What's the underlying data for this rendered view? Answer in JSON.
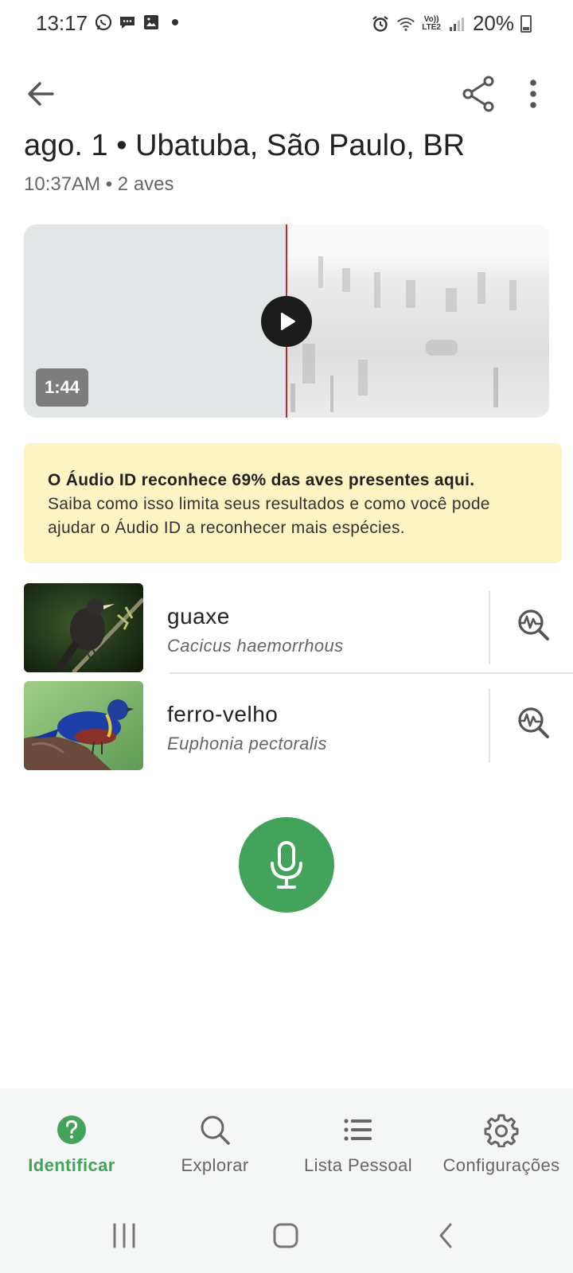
{
  "status_bar": {
    "time": "13:17",
    "battery": "20%",
    "volte_line1": "Vo))",
    "volte_line2": "LTE2"
  },
  "header": {
    "title": "ago. 1 • Ubatuba, São Paulo, BR",
    "subtitle": "10:37AM • 2 aves"
  },
  "player": {
    "duration": "1:44",
    "progress": 0.5
  },
  "notice": {
    "bold": "O Áudio ID reconhece 69% das aves presentes aqui.",
    "text": "Saiba como isso limita seus resultados e como você pode ajudar o Áudio ID a reconhecer mais espécies."
  },
  "birds": [
    {
      "name": "guaxe",
      "scientific": "Cacicus haemorrhous",
      "icon": "spectrogram-search-icon"
    },
    {
      "name": "ferro-velho",
      "scientific": "Euphonia pectoralis",
      "icon": "spectrogram-search-icon"
    }
  ],
  "bottom_nav": {
    "items": [
      {
        "label": "Identificar",
        "icon": "help-circle-icon",
        "active": true
      },
      {
        "label": "Explorar",
        "icon": "search-icon",
        "active": false
      },
      {
        "label": "Lista Pessoal",
        "icon": "list-icon",
        "active": false
      },
      {
        "label": "Configurações",
        "icon": "gear-icon",
        "active": false
      }
    ]
  },
  "colors": {
    "accent_green": "#43a35b",
    "notice_bg": "#fdf4c4",
    "playhead": "#c62828"
  }
}
